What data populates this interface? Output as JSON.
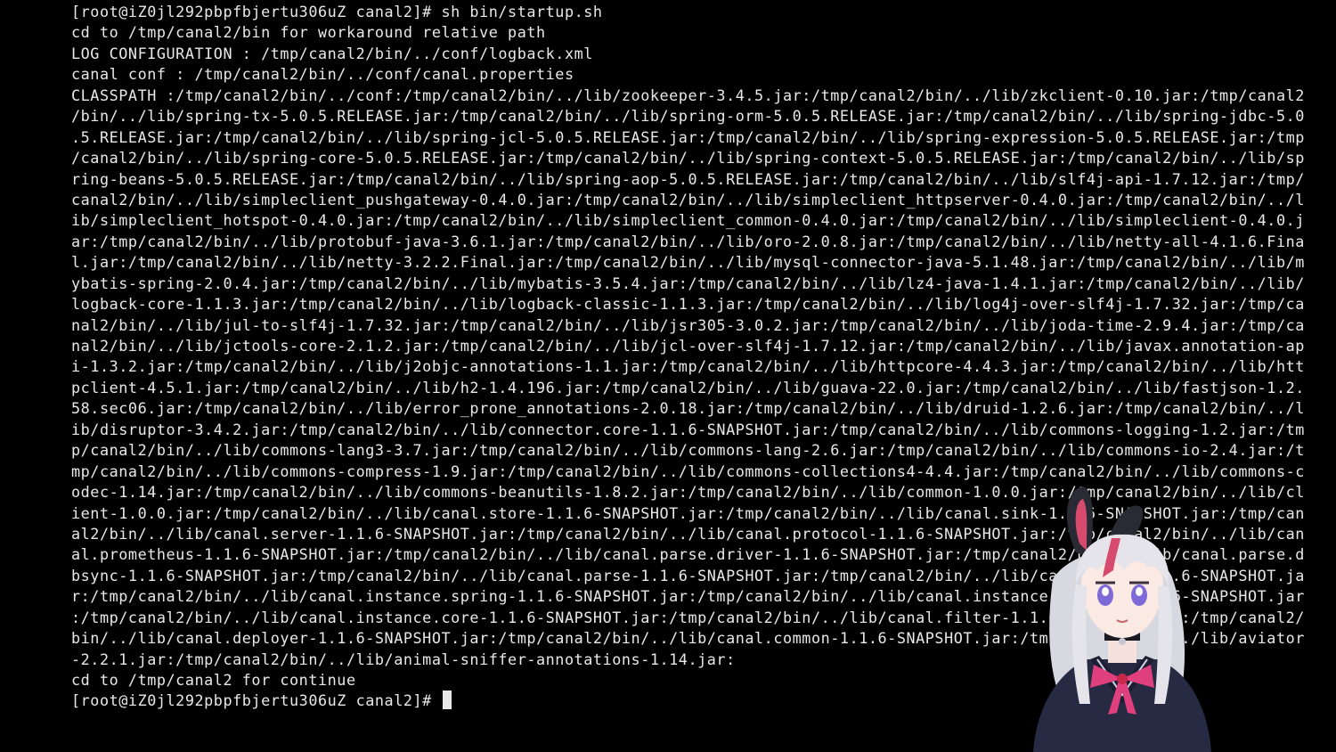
{
  "terminal": {
    "lines": [
      "[root@iZ0jl292pbpfbjertu306uZ canal2]# sh bin/startup.sh",
      "cd to /tmp/canal2/bin for workaround relative path",
      "LOG CONFIGURATION : /tmp/canal2/bin/../conf/logback.xml",
      "canal conf : /tmp/canal2/bin/../conf/canal.properties",
      "CLASSPATH :/tmp/canal2/bin/../conf:/tmp/canal2/bin/../lib/zookeeper-3.4.5.jar:/tmp/canal2/bin/../lib/zkclient-0.10.jar:/tmp/canal2",
      "/bin/../lib/spring-tx-5.0.5.RELEASE.jar:/tmp/canal2/bin/../lib/spring-orm-5.0.5.RELEASE.jar:/tmp/canal2/bin/../lib/spring-jdbc-5.0",
      ".5.RELEASE.jar:/tmp/canal2/bin/../lib/spring-jcl-5.0.5.RELEASE.jar:/tmp/canal2/bin/../lib/spring-expression-5.0.5.RELEASE.jar:/tmp",
      "/canal2/bin/../lib/spring-core-5.0.5.RELEASE.jar:/tmp/canal2/bin/../lib/spring-context-5.0.5.RELEASE.jar:/tmp/canal2/bin/../lib/sp",
      "ring-beans-5.0.5.RELEASE.jar:/tmp/canal2/bin/../lib/spring-aop-5.0.5.RELEASE.jar:/tmp/canal2/bin/../lib/slf4j-api-1.7.12.jar:/tmp/",
      "canal2/bin/../lib/simpleclient_pushgateway-0.4.0.jar:/tmp/canal2/bin/../lib/simpleclient_httpserver-0.4.0.jar:/tmp/canal2/bin/../l",
      "ib/simpleclient_hotspot-0.4.0.jar:/tmp/canal2/bin/../lib/simpleclient_common-0.4.0.jar:/tmp/canal2/bin/../lib/simpleclient-0.4.0.j",
      "ar:/tmp/canal2/bin/../lib/protobuf-java-3.6.1.jar:/tmp/canal2/bin/../lib/oro-2.0.8.jar:/tmp/canal2/bin/../lib/netty-all-4.1.6.Fina",
      "l.jar:/tmp/canal2/bin/../lib/netty-3.2.2.Final.jar:/tmp/canal2/bin/../lib/mysql-connector-java-5.1.48.jar:/tmp/canal2/bin/../lib/m",
      "ybatis-spring-2.0.4.jar:/tmp/canal2/bin/../lib/mybatis-3.5.4.jar:/tmp/canal2/bin/../lib/lz4-java-1.4.1.jar:/tmp/canal2/bin/../lib/",
      "logback-core-1.1.3.jar:/tmp/canal2/bin/../lib/logback-classic-1.1.3.jar:/tmp/canal2/bin/../lib/log4j-over-slf4j-1.7.32.jar:/tmp/ca",
      "nal2/bin/../lib/jul-to-slf4j-1.7.32.jar:/tmp/canal2/bin/../lib/jsr305-3.0.2.jar:/tmp/canal2/bin/../lib/joda-time-2.9.4.jar:/tmp/ca",
      "nal2/bin/../lib/jctools-core-2.1.2.jar:/tmp/canal2/bin/../lib/jcl-over-slf4j-1.7.12.jar:/tmp/canal2/bin/../lib/javax.annotation-ap",
      "i-1.3.2.jar:/tmp/canal2/bin/../lib/j2objc-annotations-1.1.jar:/tmp/canal2/bin/../lib/httpcore-4.4.3.jar:/tmp/canal2/bin/../lib/htt",
      "pclient-4.5.1.jar:/tmp/canal2/bin/../lib/h2-1.4.196.jar:/tmp/canal2/bin/../lib/guava-22.0.jar:/tmp/canal2/bin/../lib/fastjson-1.2.",
      "58.sec06.jar:/tmp/canal2/bin/../lib/error_prone_annotations-2.0.18.jar:/tmp/canal2/bin/../lib/druid-1.2.6.jar:/tmp/canal2/bin/../l",
      "ib/disruptor-3.4.2.jar:/tmp/canal2/bin/../lib/connector.core-1.1.6-SNAPSHOT.jar:/tmp/canal2/bin/../lib/commons-logging-1.2.jar:/tm",
      "p/canal2/bin/../lib/commons-lang3-3.7.jar:/tmp/canal2/bin/../lib/commons-lang-2.6.jar:/tmp/canal2/bin/../lib/commons-io-2.4.jar:/t",
      "mp/canal2/bin/../lib/commons-compress-1.9.jar:/tmp/canal2/bin/../lib/commons-collections4-4.4.jar:/tmp/canal2/bin/../lib/commons-c",
      "odec-1.14.jar:/tmp/canal2/bin/../lib/commons-beanutils-1.8.2.jar:/tmp/canal2/bin/../lib/common-1.0.0.jar:/tmp/canal2/bin/../lib/cl",
      "ient-1.0.0.jar:/tmp/canal2/bin/../lib/canal.store-1.1.6-SNAPSHOT.jar:/tmp/canal2/bin/../lib/canal.sink-1.1.6-SNAPSHOT.jar:/tmp/can",
      "al2/bin/../lib/canal.server-1.1.6-SNAPSHOT.jar:/tmp/canal2/bin/../lib/canal.protocol-1.1.6-SNAPSHOT.jar:/tmp/canal2/bin/../lib/can",
      "al.prometheus-1.1.6-SNAPSHOT.jar:/tmp/canal2/bin/../lib/canal.parse.driver-1.1.6-SNAPSHOT.jar:/tmp/canal2/bin/../lib/canal.parse.d",
      "bsync-1.1.6-SNAPSHOT.jar:/tmp/canal2/bin/../lib/canal.parse-1.1.6-SNAPSHOT.jar:/tmp/canal2/bin/../lib/canal.meta-1.1.6-SNAPSHOT.ja",
      "r:/tmp/canal2/bin/../lib/canal.instance.spring-1.1.6-SNAPSHOT.jar:/tmp/canal2/bin/../lib/canal.instance.manager-1.1.6-SNAPSHOT.jar",
      ":/tmp/canal2/bin/../lib/canal.instance.core-1.1.6-SNAPSHOT.jar:/tmp/canal2/bin/../lib/canal.filter-1.1.6-SNAPSHOT.jar:/tmp/canal2/",
      "bin/../lib/canal.deployer-1.1.6-SNAPSHOT.jar:/tmp/canal2/bin/../lib/canal.common-1.1.6-SNAPSHOT.jar:/tmp/canal2/bin/../lib/aviator",
      "-2.2.1.jar:/tmp/canal2/bin/../lib/animal-sniffer-annotations-1.14.jar:",
      "cd to /tmp/canal2 for continue"
    ],
    "prompt": "[root@iZ0jl292pbpfbjertu306uZ canal2]# ",
    "colors": {
      "background": "#000000",
      "foreground": "#e8e8e8"
    }
  },
  "avatar": {
    "icon": "anime-avatar-icon",
    "colors": {
      "hair": "#e4e4ea",
      "uniform": "#262a42",
      "bow": "#e0407e",
      "ribbon": "#c8284a"
    }
  }
}
